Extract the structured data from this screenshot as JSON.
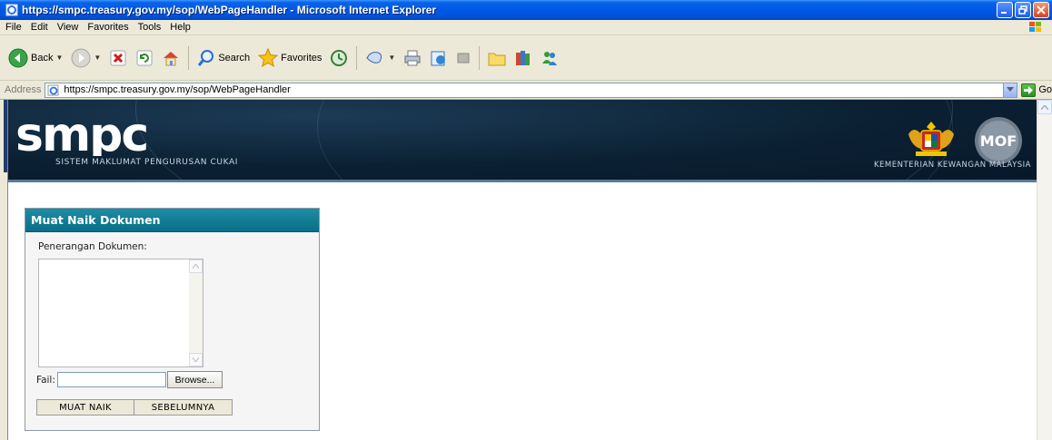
{
  "window": {
    "title": "https://smpc.treasury.gov.my/sop/WebPageHandler - Microsoft Internet Explorer",
    "title_color": "#0058e6"
  },
  "menu": {
    "items": [
      "File",
      "Edit",
      "View",
      "Favorites",
      "Tools",
      "Help"
    ]
  },
  "toolbar": {
    "back_label": "Back",
    "search_label": "Search",
    "favorites_label": "Favorites"
  },
  "address": {
    "label": "Address",
    "url": "https://smpc.treasury.gov.my/sop/WebPageHandler",
    "go_label": "Go"
  },
  "banner": {
    "logo_text": "smpc",
    "subtitle": "SISTEM MAKLUMAT PENGURUSAN CUKAI",
    "ministry": "KEMENTERIAN KEWANGAN MALAYSIA",
    "mof_text": "MOF",
    "background_color": "#0b2133"
  },
  "panel": {
    "title": "Muat Naik Dokumen",
    "header_color": "#0a7a92",
    "description_label": "Penerangan Dokumen:",
    "description_value": "",
    "file_label": "Fail:",
    "file_value": "",
    "browse_label": "Browse...",
    "upload_label": "MUAT NAIK",
    "back_label": "SEBELUMNYA"
  }
}
